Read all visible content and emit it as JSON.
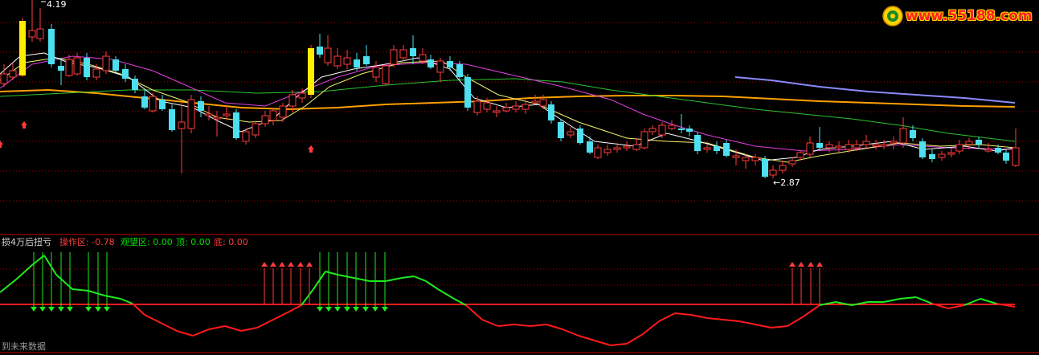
{
  "price_panel": {
    "high_label": "4.19",
    "low_label": "←2.87"
  },
  "indicator": {
    "title": "损4万后扭亏",
    "fields": [
      {
        "label": "操作区: -0.78",
        "color": "#ff3b3b"
      },
      {
        "label": "观望区: 0.00",
        "color": "#00e000"
      },
      {
        "label": "顶: 0.00",
        "color": "#00e000"
      },
      {
        "label": "底: 0.00",
        "color": "#ff3b3b"
      }
    ]
  },
  "footer_note": "到未来数据",
  "watermark": {
    "text": "www.55188.com"
  },
  "colors": {
    "background": "#000000",
    "up_candle": "#ff3b3b",
    "down_candle": "#4ce0f0",
    "limit_up_candle": "#ffee00",
    "ma5": "#ffffff",
    "ma10": "#f5f56e",
    "ma20": "#e040e0",
    "ma60": "#2ec42e",
    "ma120": "#ffa000",
    "ma250": "#8a8aff",
    "grid": "#b00000",
    "indicator_line_above": "#1eea1e",
    "indicator_line_below": "#ff1a1a",
    "up_arrow": "#ff3b3b",
    "down_arrow": "#1eea1e"
  },
  "chart_data": {
    "type": "candlestick",
    "price_high": 4.19,
    "price_low": 2.87
  }
}
